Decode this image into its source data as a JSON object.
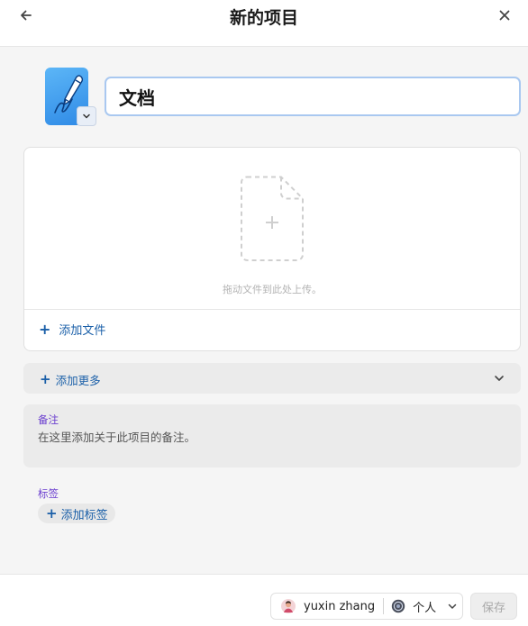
{
  "header": {
    "title": "新的项目",
    "back_icon": "arrow-left-icon",
    "close_icon": "close-icon"
  },
  "item": {
    "icon_name": "pen-signature-icon",
    "name_value": "文档"
  },
  "files": {
    "drop_hint": "拖动文件到此处上传。",
    "add_file_label": "添加文件"
  },
  "more": {
    "label": "添加更多"
  },
  "notes": {
    "label": "备注",
    "placeholder": "在这里添加关于此项目的备注。"
  },
  "tags": {
    "label": "标签",
    "add_label": "添加标签"
  },
  "footer": {
    "owner_name": "yuxin zhang",
    "space_name": "个人",
    "save_label": "保存"
  },
  "colors": {
    "accent_link": "#1a5fa8",
    "label_purple": "#6b3fcf",
    "input_focus": "#a9c8f0",
    "icon_blue": "#2f8ae6"
  }
}
